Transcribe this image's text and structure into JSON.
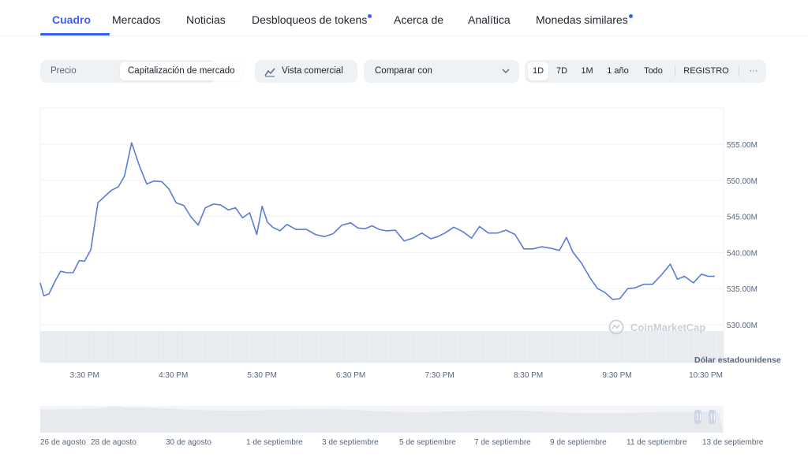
{
  "tabs": [
    {
      "label": "Cuadro",
      "active": true,
      "dot": false
    },
    {
      "label": "Mercados",
      "active": false,
      "dot": false
    },
    {
      "label": "Noticias",
      "active": false,
      "dot": false
    },
    {
      "label": "Desbloqueos de tokens",
      "active": false,
      "dot": true
    },
    {
      "label": "Acerca de",
      "active": false,
      "dot": false
    },
    {
      "label": "Analítica",
      "active": false,
      "dot": false
    },
    {
      "label": "Monedas similares",
      "active": false,
      "dot": true
    }
  ],
  "toolbar": {
    "metric_toggle": [
      {
        "label": "Precio",
        "active": false
      },
      {
        "label": "Capitalización de mercado",
        "active": true
      }
    ],
    "trading_view_label": "Vista comercial",
    "compare": {
      "placeholder": "Comparar con"
    },
    "ranges": [
      {
        "label": "1D",
        "active": true
      },
      {
        "label": "7D",
        "active": false
      },
      {
        "label": "1M",
        "active": false
      },
      {
        "label": "1 año",
        "active": false
      },
      {
        "label": "Todo",
        "active": false
      },
      {
        "label": "REGISTRO",
        "active": false
      }
    ],
    "more_label": "···"
  },
  "watermark": "CoinMarketCap",
  "colors": {
    "accent": "#3861fb",
    "line": "#5b7bd9",
    "grid": "#f0f2f5"
  },
  "chart_data": {
    "type": "line",
    "y_ticks": [
      "555.00M",
      "550.00M",
      "545.00M",
      "540.00M",
      "535.00M",
      "530.00M"
    ],
    "y_tick_values": [
      555,
      550,
      545,
      540,
      535,
      530
    ],
    "ylim": [
      528,
      560
    ],
    "x_ticks": [
      "3:30 PM",
      "4:30 PM",
      "5:30 PM",
      "6:30 PM",
      "7:30 PM",
      "8:30 PM",
      "9:30 PM",
      "10:30 PM"
    ],
    "x_tick_positions_hours": [
      15.5,
      16.5,
      17.5,
      18.5,
      19.5,
      20.5,
      21.5,
      22.5
    ],
    "currency_label": "Dólar estadounidense",
    "unit": "M USD",
    "series": [
      {
        "x": [
          15.0,
          15.04,
          15.1,
          15.17,
          15.23,
          15.3,
          15.37,
          15.44,
          15.5,
          15.57,
          15.65,
          15.72,
          15.8,
          15.88,
          15.95,
          16.03,
          16.12,
          16.2,
          16.28,
          16.37,
          16.45,
          16.53,
          16.62,
          16.7,
          16.78,
          16.86,
          16.95,
          17.03,
          17.12,
          17.2,
          17.28,
          17.36,
          17.44,
          17.5,
          17.56,
          17.62,
          17.7,
          17.78,
          17.88,
          18.0,
          18.1,
          18.2,
          18.3,
          18.4,
          18.5,
          18.58,
          18.66,
          18.74,
          18.82,
          18.9,
          19.0,
          19.1,
          19.2,
          19.3,
          19.4,
          19.48,
          19.56,
          19.66,
          19.76,
          19.86,
          19.95,
          20.05,
          20.15,
          20.25,
          20.35,
          20.45,
          20.55,
          20.65,
          20.75,
          20.85,
          20.93,
          21.0,
          21.1,
          21.2,
          21.28,
          21.36,
          21.45,
          21.53,
          21.62,
          21.7,
          21.8,
          21.9,
          22.0,
          22.1,
          22.18,
          22.26,
          22.36,
          22.45,
          22.53,
          22.6
        ],
        "y": [
          535.8,
          534.0,
          534.3,
          536.1,
          537.4,
          537.2,
          537.2,
          538.9,
          538.8,
          540.4,
          546.9,
          547.7,
          548.6,
          549.1,
          550.6,
          555.2,
          551.9,
          549.5,
          549.9,
          549.8,
          548.8,
          546.9,
          546.5,
          544.9,
          543.8,
          546.2,
          546.7,
          546.6,
          545.9,
          546.2,
          544.8,
          545.5,
          542.5,
          546.4,
          544.2,
          543.5,
          543.0,
          543.9,
          543.2,
          543.2,
          542.5,
          542.2,
          542.6,
          543.8,
          544.1,
          543.4,
          543.3,
          543.7,
          543.2,
          543.0,
          543.1,
          541.6,
          542.0,
          542.7,
          541.9,
          542.2,
          542.7,
          543.5,
          542.9,
          542.0,
          543.6,
          542.7,
          542.7,
          543.1,
          542.5,
          540.5,
          540.5,
          540.8,
          540.6,
          540.3,
          542.1,
          540.1,
          538.5,
          536.4,
          535.0,
          534.5,
          533.5,
          533.6,
          535.0,
          535.1,
          535.6,
          535.6,
          536.9,
          538.4,
          536.3,
          536.7,
          535.8,
          537.0,
          536.7,
          536.7
        ]
      }
    ]
  },
  "navigator": {
    "labels": [
      "26 de agosto",
      "28 de agosto",
      "30 de agosto",
      "1 de septiembre",
      "3 de septiembre",
      "5 de septiembre",
      "7 de septiembre",
      "9 de septiembre",
      "11 de septiembre",
      "13 de septiembre"
    ]
  }
}
